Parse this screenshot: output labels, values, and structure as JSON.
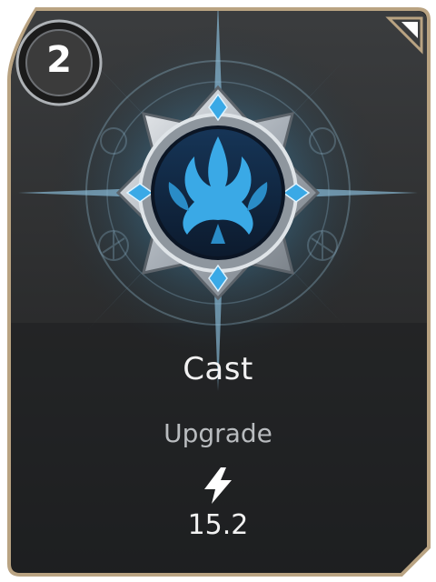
{
  "card": {
    "cost": "2",
    "title": "Cast",
    "type": "Upgrade",
    "value": "15.2",
    "icons": {
      "cost_badge": "cost-badge-icon",
      "emblem": "blue-trident-emblem-icon",
      "stat": "lightning-bolt-icon",
      "corner": "corner-triangle-icon"
    },
    "colors": {
      "frame_border": "#b9a382",
      "card_background": "#2a2a2a",
      "glow": "#4fb6f0",
      "emblem_blue": "#3aa9e6",
      "text": "#f2f2f2",
      "subtitle_text": "#b9bcbf"
    }
  }
}
